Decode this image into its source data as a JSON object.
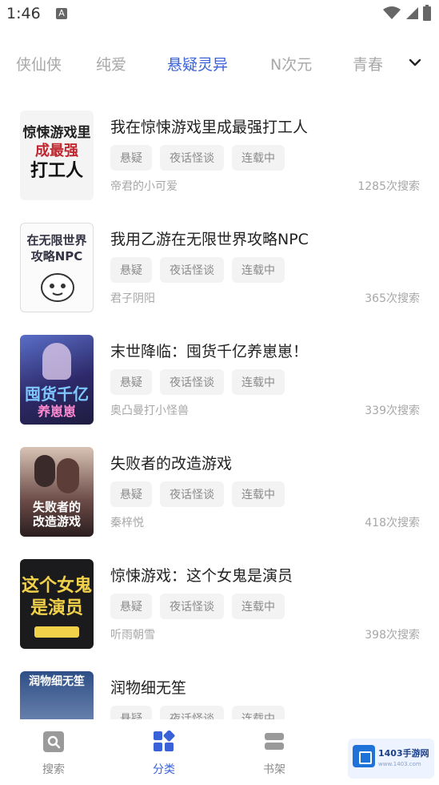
{
  "status_bar": {
    "time": "1:46",
    "notification_letter": "A"
  },
  "tabs": {
    "items": [
      "侠仙侠",
      "纯爱",
      "悬疑灵异",
      "N次元",
      "青春"
    ],
    "active_index": 2
  },
  "books": [
    {
      "title": "我在惊悚游戏里成最强打工人",
      "tags": [
        "悬疑",
        "夜话怪谈",
        "连载中"
      ],
      "author": "帝君的小可爱",
      "search_count": "1285次搜索",
      "cover_text": "惊悚游戏里成最强打工人"
    },
    {
      "title": "我用乙游在无限世界攻略NPC",
      "tags": [
        "悬疑",
        "夜话怪谈",
        "连载中"
      ],
      "author": "君子阴阳",
      "search_count": "365次搜索",
      "cover_text": "在无限世界攻略NPC"
    },
    {
      "title": "末世降临：囤货千亿养崽崽！",
      "tags": [
        "悬疑",
        "夜话怪谈",
        "连载中"
      ],
      "author": "奥凸曼打小怪兽",
      "search_count": "339次搜索",
      "cover_text": "囤货千亿养崽崽"
    },
    {
      "title": "失败者的改造游戏",
      "tags": [
        "悬疑",
        "夜话怪谈",
        "连载中"
      ],
      "author": "秦梓悦",
      "search_count": "418次搜索",
      "cover_text": "失败者的改造游戏"
    },
    {
      "title": "惊悚游戏：这个女鬼是演员",
      "tags": [
        "悬疑",
        "夜话怪谈",
        "连载中"
      ],
      "author": "听雨朝雪",
      "search_count": "398次搜索",
      "cover_text": "这个女鬼是演员"
    },
    {
      "title": "润物细无笙",
      "tags": [
        "悬疑",
        "夜话怪谈",
        "连载中"
      ],
      "author": "",
      "search_count": "",
      "cover_text": "润物细无笙"
    }
  ],
  "bottom_nav": {
    "items": [
      {
        "label": "搜索",
        "icon": "search-icon"
      },
      {
        "label": "分类",
        "icon": "category-grid-icon"
      },
      {
        "label": "书架",
        "icon": "bookshelf-icon"
      }
    ],
    "active_index": 1
  },
  "watermark": {
    "text": "1403手游网",
    "sub": "www.1403.com"
  },
  "colors": {
    "accent": "#3a62d8",
    "muted": "#a7a7a7",
    "tag_bg": "#f3f3f3"
  }
}
